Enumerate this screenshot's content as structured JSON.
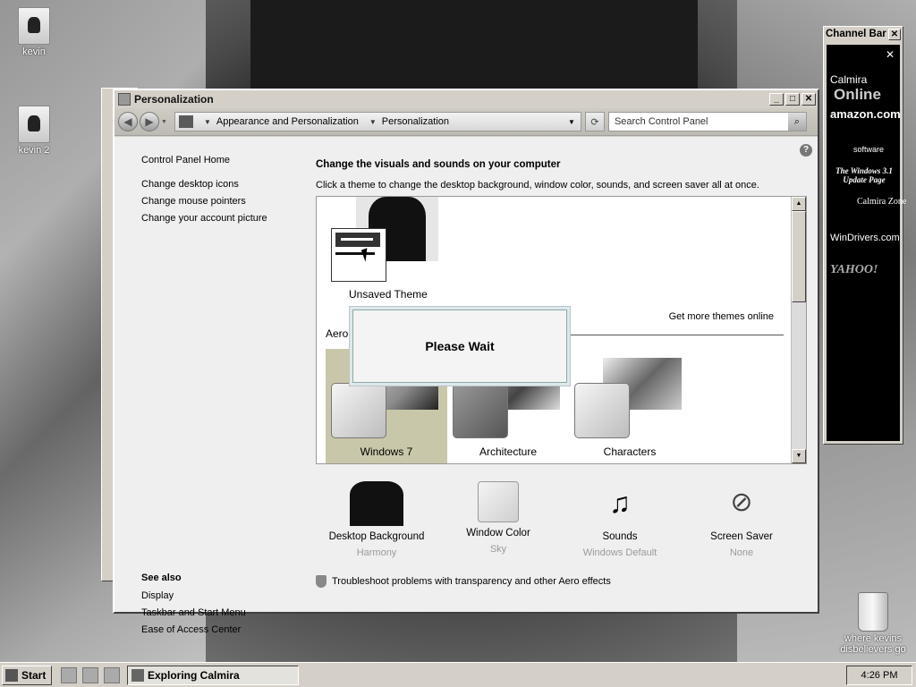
{
  "desktop": {
    "icons": [
      {
        "label": "kevin"
      },
      {
        "label": "kevin 2"
      },
      {
        "label": "where kevins disbelievers go"
      }
    ]
  },
  "window": {
    "title": "Personalization",
    "address": {
      "crumbs": [
        "Appearance and Personalization",
        "Personalization"
      ]
    },
    "search": {
      "placeholder": "Search Control Panel"
    },
    "left_nav": {
      "home": "Control Panel Home",
      "links": [
        "Change desktop icons",
        "Change mouse pointers",
        "Change your account picture"
      ]
    },
    "see_also": {
      "header": "See also",
      "links": [
        "Display",
        "Taskbar and Start Menu",
        "Ease of Access Center"
      ]
    },
    "main": {
      "title": "Change the visuals and sounds on your computer",
      "subtitle": "Click a theme to change the desktop background, window color, sounds, and screen saver all at once.",
      "unsaved_theme": "Unsaved Theme",
      "get_more": "Get more themes online",
      "aero_label": "Aero",
      "themes": [
        "Windows 7",
        "Architecture",
        "Characters"
      ],
      "dialog": "Please Wait"
    },
    "bottom": [
      {
        "label": "Desktop Background",
        "sub": "Harmony"
      },
      {
        "label": "Window Color",
        "sub": "Sky"
      },
      {
        "label": "Sounds",
        "sub": "Windows Default"
      },
      {
        "label": "Screen Saver",
        "sub": "None"
      }
    ],
    "troubleshoot": "Troubleshoot problems with transparency and other Aero effects"
  },
  "channel_bar": {
    "title": "Channel Bar",
    "close": "✕",
    "channels": [
      "Calmira",
      "Online",
      "amazon.com",
      "software",
      "The Windows 3.1 Update Page",
      "Calmira Zone",
      "WinDrivers.com",
      "YAHOO!"
    ]
  },
  "taskbar": {
    "start": "Start",
    "task": "Exploring Calmira",
    "clock": "4:26 PM"
  }
}
